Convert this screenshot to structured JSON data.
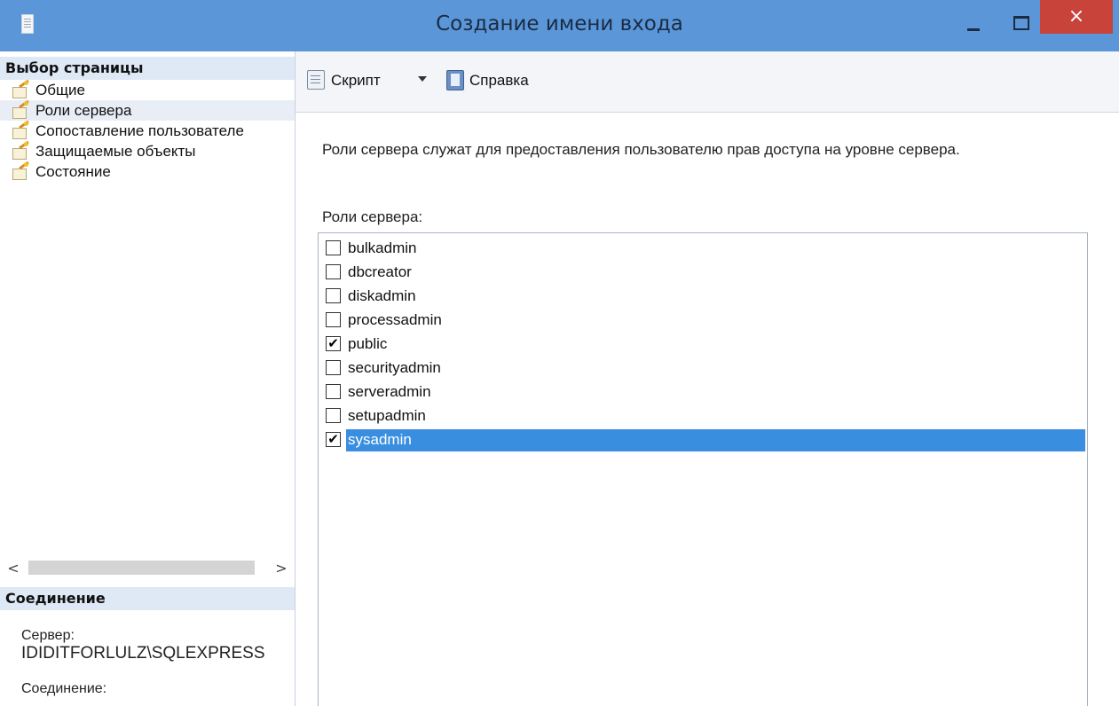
{
  "window": {
    "title": "Создание имени входа",
    "close_glyph": "×"
  },
  "left_pane": {
    "page_select_header": "Выбор страницы",
    "pages": [
      {
        "label": "Общие",
        "icon": "page-wand-icon"
      },
      {
        "label": "Роли сервера",
        "icon": "page-wand-icon",
        "selected": true
      },
      {
        "label": "Сопоставление пользователе",
        "icon": "page-wand-icon"
      },
      {
        "label": "Защищаемые объекты",
        "icon": "page-wand-icon"
      },
      {
        "label": "Состояние",
        "icon": "page-wand-icon"
      }
    ],
    "scroll_left": "<",
    "scroll_right": ">",
    "connection_header": "Соединение",
    "server_label": "Сервер:",
    "server_value": "IDIDITFORLULZ\\SQLEXPRESS",
    "connection_label": "Соединение:"
  },
  "toolbar": {
    "script_label": "Скрипт",
    "help_label": "Справка"
  },
  "main": {
    "description": "Роли сервера служат для предоставления пользователю прав доступа на уровне сервера.",
    "roles_label": "Роли сервера:",
    "roles": [
      {
        "name": "bulkadmin",
        "checked": false
      },
      {
        "name": "dbcreator",
        "checked": false
      },
      {
        "name": "diskadmin",
        "checked": false
      },
      {
        "name": "processadmin",
        "checked": false
      },
      {
        "name": "public",
        "checked": true
      },
      {
        "name": "securityadmin",
        "checked": false
      },
      {
        "name": "serveradmin",
        "checked": false
      },
      {
        "name": "setupadmin",
        "checked": false
      },
      {
        "name": "sysadmin",
        "checked": true,
        "selected": true
      }
    ],
    "check_glyph": "✔"
  },
  "colors": {
    "titlebar": "#5b97d8",
    "close_button": "#c8433a",
    "selection": "#3a8ee0",
    "section_header": "#dfe8f5"
  }
}
